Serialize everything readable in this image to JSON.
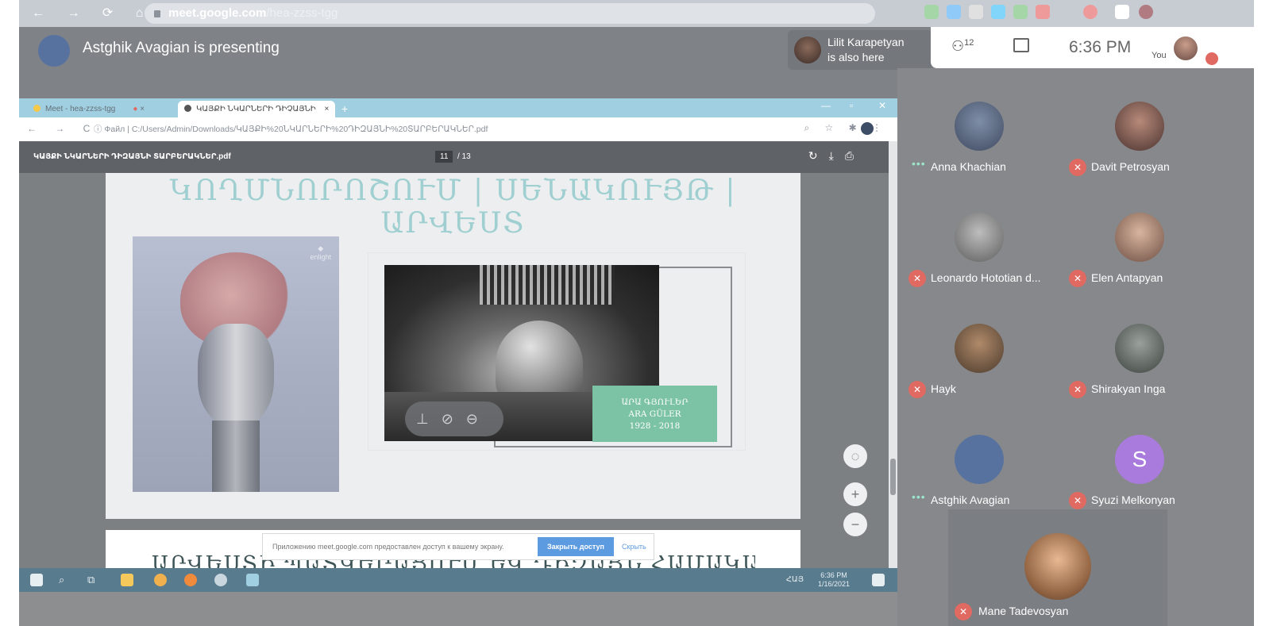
{
  "browser": {
    "url_host": "meet.google.com",
    "url_path": "/hea-zzss-tgg"
  },
  "meet": {
    "presenting_text": "Astghik Avagian is presenting",
    "also_here_name": "Lilit Karapetyan",
    "also_here_suffix": "is also here",
    "participant_count": "12",
    "time": "6:36 PM",
    "you_label": "You"
  },
  "shared_screen": {
    "tabs": [
      {
        "label": "Meet - hea-zzss-tgg"
      },
      {
        "label": "ԿԱՅՔԻ ՆԿԱՐՆԵՐԻ ԴԻՉԱՅՆԻ"
      }
    ],
    "address_prefix": "Файл",
    "address_path": "C:/Users/Admin/Downloads/ԿԱՅՔԻ%20ՆԿԱՐՆԵՐԻ%20ԴԻԶԱՅՆԻ%20ՏԱՐԲԵՐԱԿՆԵՐ.pdf",
    "pdf_title": "ԿԱՅՔԻ ՆԿԱՐՆԵՐԻ ԴԻԶԱՅՆԻ ՏԱՐԲԵՐԱԿՆԵՐ.pdf",
    "page_current": "11",
    "page_total": "/ 13",
    "slide_heading": "ԿՈՂՄՆՈՐՈՇՈՒՄ | ՍԵՆԱԿՈՒՅԹ | ԱՐՎԵՍՏ",
    "sculpture_brand": "enlight",
    "photo_caption_line1": "ԱՐԱ ԳՅՈՒԼԵՐ",
    "photo_caption_line2": "ARA GÜLER",
    "photo_caption_line3": "1928 - 2018",
    "next_page_heading": "ԱՐՎԵՍՏԻ ՊԱՏԿԵՐԱՑՈՒՄ ԵՎ ԴԻԶԱՅՆ ՀԱՄԱԿԱՐԳՈՒՄ",
    "share_message": "Приложению meet.google.com предоставлен доступ к вашему экрану.",
    "share_stop": "Закрыть доступ",
    "share_hide": "Скрыть",
    "taskbar_lang": "ՀԱՅ",
    "taskbar_time": "6:36 PM",
    "taskbar_date": "1/16/2021"
  },
  "participants": [
    {
      "name": "Anna Khachian",
      "status": "speaking",
      "icon": "dots-icon"
    },
    {
      "name": "Davit Petrosyan",
      "status": "muted",
      "icon": "mic-off-icon"
    },
    {
      "name": "Leonardo Hototian d...",
      "status": "muted",
      "icon": "mic-off-icon"
    },
    {
      "name": "Elen Antapyan",
      "status": "muted",
      "icon": "mic-off-icon"
    },
    {
      "name": "Hayk",
      "status": "muted",
      "icon": "mic-off-icon"
    },
    {
      "name": "Shirakyan Inga",
      "status": "muted",
      "icon": "mic-off-icon"
    },
    {
      "name": "Astghik Avagian",
      "status": "speaking",
      "icon": "dots-icon"
    },
    {
      "name": "Syuzi Melkonyan",
      "status": "muted",
      "icon": "mic-off-icon",
      "initial": "S"
    },
    {
      "name": "Mane Tadevosyan",
      "status": "muted",
      "icon": "mic-off-icon"
    }
  ],
  "colors": {
    "muted_red": "#e06a62",
    "avatar_purple": "#a97bdd",
    "presenter_blue": "#5872a0",
    "slide_green": "#7cc3a5"
  }
}
